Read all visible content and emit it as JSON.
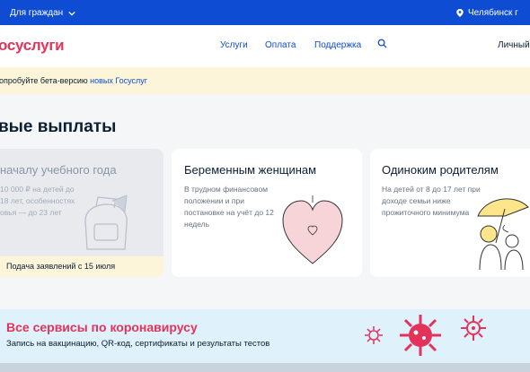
{
  "topbar": {
    "audience": "Для граждан",
    "city": "Челябинск г"
  },
  "header": {
    "logo": "осуслуги",
    "nav": {
      "services": "Услуги",
      "payment": "Оплата",
      "support": "Поддержка",
      "account": "Личный"
    }
  },
  "beta_banner": {
    "text": "опробуйте бета-версию ",
    "link": "новых Госуслуг"
  },
  "section": {
    "title": "вые выплаты"
  },
  "cards": [
    {
      "title": "началу учебного года",
      "description": "10 000 ₽ на детей до 18 лет, особенностях овья — до 23 лет",
      "deadline": "Подача заявлений с 15 июля"
    },
    {
      "title": "Беременным женщинам",
      "description": "В трудном финансовом положении и при постановке на учёт до 12 недель"
    },
    {
      "title": "Одиноким родителям",
      "description": "На детей от 8 до 17 лет при доходе семьи ниже прожиточного минимума"
    }
  ],
  "covid": {
    "title": "Все сервисы по коронавирусу",
    "subtitle": "Запись на вакцинацию, QR-код, сертификаты и результаты тестов"
  },
  "colors": {
    "primary_blue": "#0d4cd3",
    "brand_red": "#e3335b",
    "beta_bg": "#fdf5d9",
    "covid_bg": "#dff2fb"
  }
}
